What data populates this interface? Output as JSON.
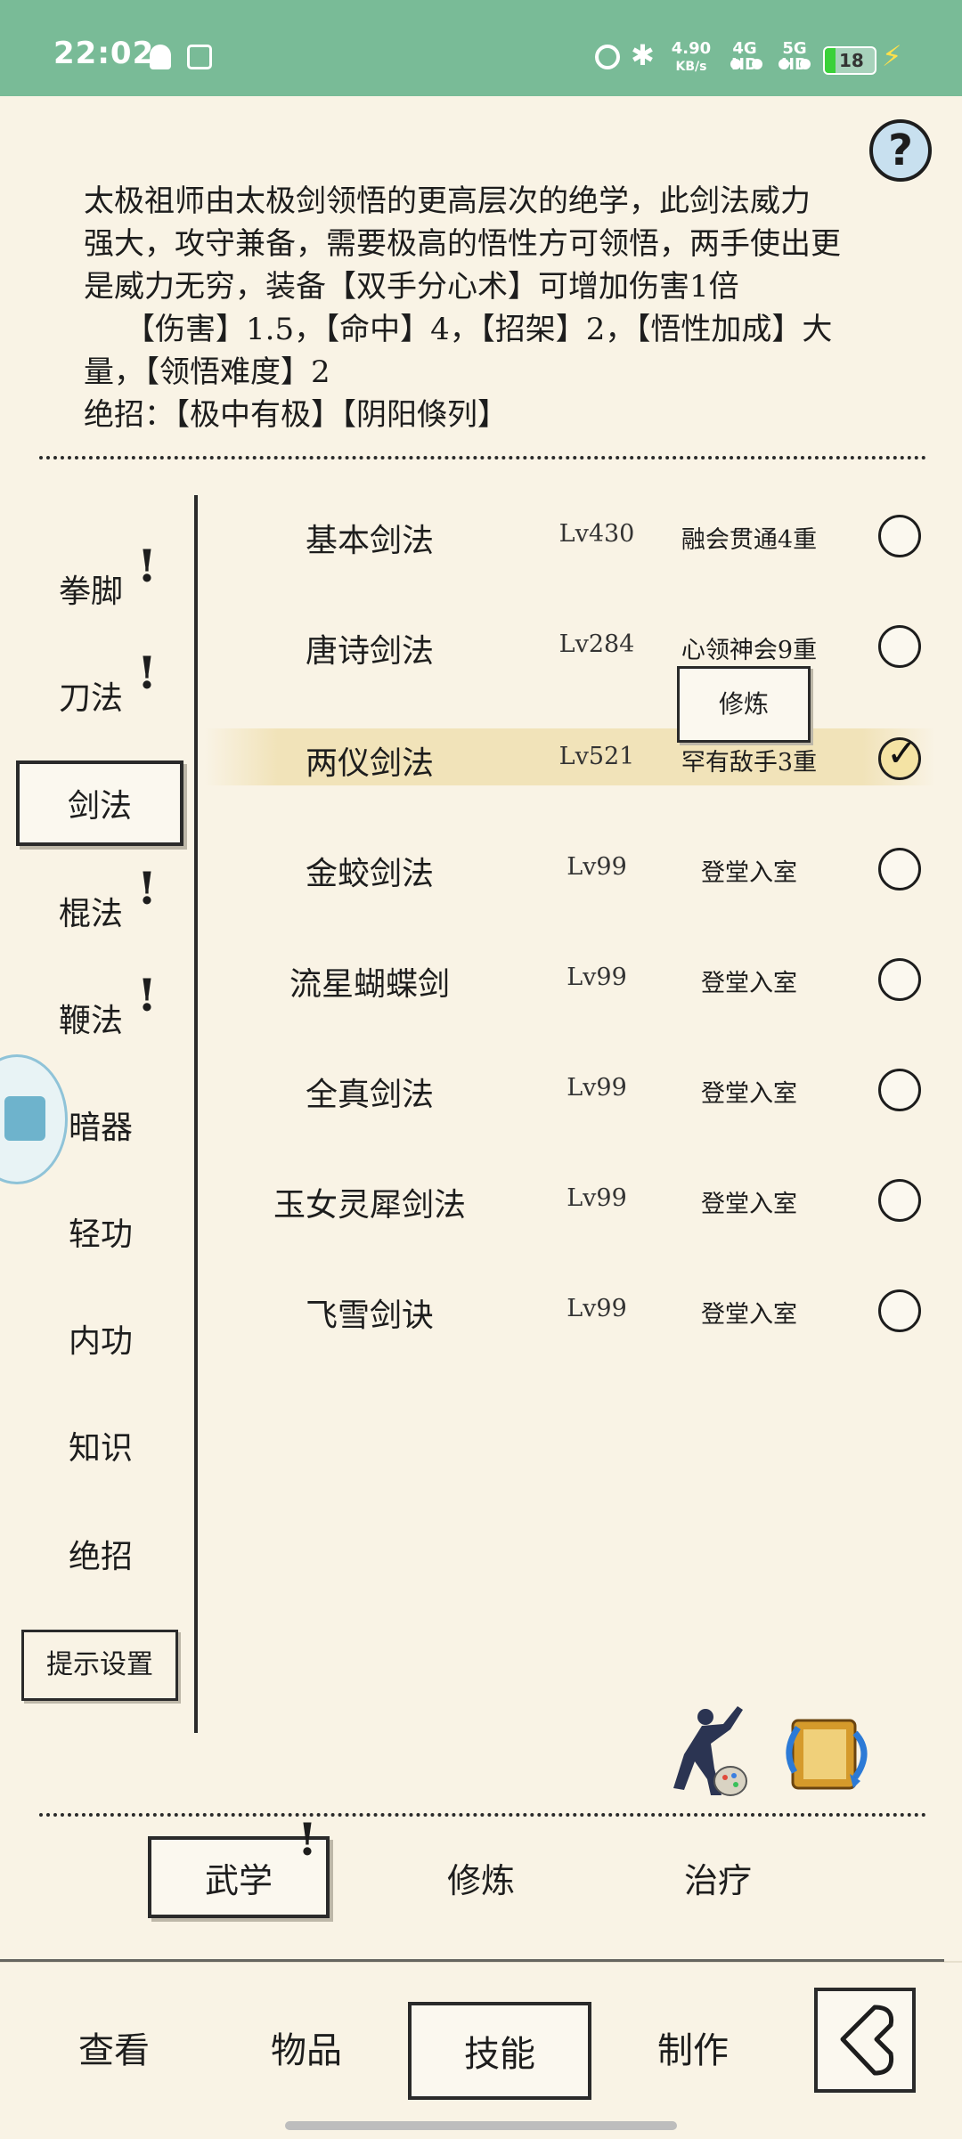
{
  "status_bar": {
    "time": "22:02",
    "speed_value": "4.90",
    "speed_unit": "KB/s",
    "net1": "4G HD",
    "net2": "5G HD",
    "battery": "18"
  },
  "help_label": "?",
  "description": {
    "line1": "太极祖师由太极剑领悟的更高层次的绝学，此剑法威力",
    "line2": "强大，攻守兼备，需要极高的悟性方可领悟，两手使出更",
    "line3": "是威力无穷，装备【双手分心术】可增加伤害1倍",
    "line4": "【伤害】1.5，【命中】4，【招架】2，【悟性加成】大",
    "line5": "量，【领悟难度】2",
    "line6": "绝招：【极中有极】【阴阳倏列】"
  },
  "categories": [
    {
      "label": "拳脚",
      "alert": "!"
    },
    {
      "label": "刀法",
      "alert": "!"
    },
    {
      "label": "剑法"
    },
    {
      "label": "棍法",
      "alert": "!"
    },
    {
      "label": "鞭法",
      "alert": "!"
    },
    {
      "label": "暗器"
    },
    {
      "label": "轻功"
    },
    {
      "label": "内功"
    },
    {
      "label": "知识"
    },
    {
      "label": "绝招"
    }
  ],
  "hint_settings_label": "提示设置",
  "skills": [
    {
      "name": "基本剑法",
      "level": "Lv430",
      "stage": "融会贯通4重"
    },
    {
      "name": "唐诗剑法",
      "level": "Lv284",
      "stage": "心领神会9重"
    },
    {
      "name": "两仪剑法",
      "level": "Lv521",
      "stage": "罕有敌手3重"
    },
    {
      "name": "金蛟剑法",
      "level": "Lv99",
      "stage": "登堂入室"
    },
    {
      "name": "流星蝴蝶剑",
      "level": "Lv99",
      "stage": "登堂入室"
    },
    {
      "name": "全真剑法",
      "level": "Lv99",
      "stage": "登堂入室"
    },
    {
      "name": "玉女灵犀剑法",
      "level": "Lv99",
      "stage": "登堂入室"
    },
    {
      "name": "飞雪剑诀",
      "level": "Lv99",
      "stage": "登堂入室"
    }
  ],
  "selected_skill_index": 2,
  "practice_popup_label": "修炼",
  "sub_tabs": [
    {
      "label": "武学",
      "alert": "!"
    },
    {
      "label": "修炼"
    },
    {
      "label": "治疗"
    }
  ],
  "bottom_nav": [
    {
      "label": "查看"
    },
    {
      "label": "物品"
    },
    {
      "label": "技能"
    },
    {
      "label": "制作"
    }
  ],
  "icons": {
    "help": "question-icon",
    "character": "martial-artist-icon",
    "scroll": "scroll-swap-icon",
    "back": "back-arrow-icon"
  }
}
